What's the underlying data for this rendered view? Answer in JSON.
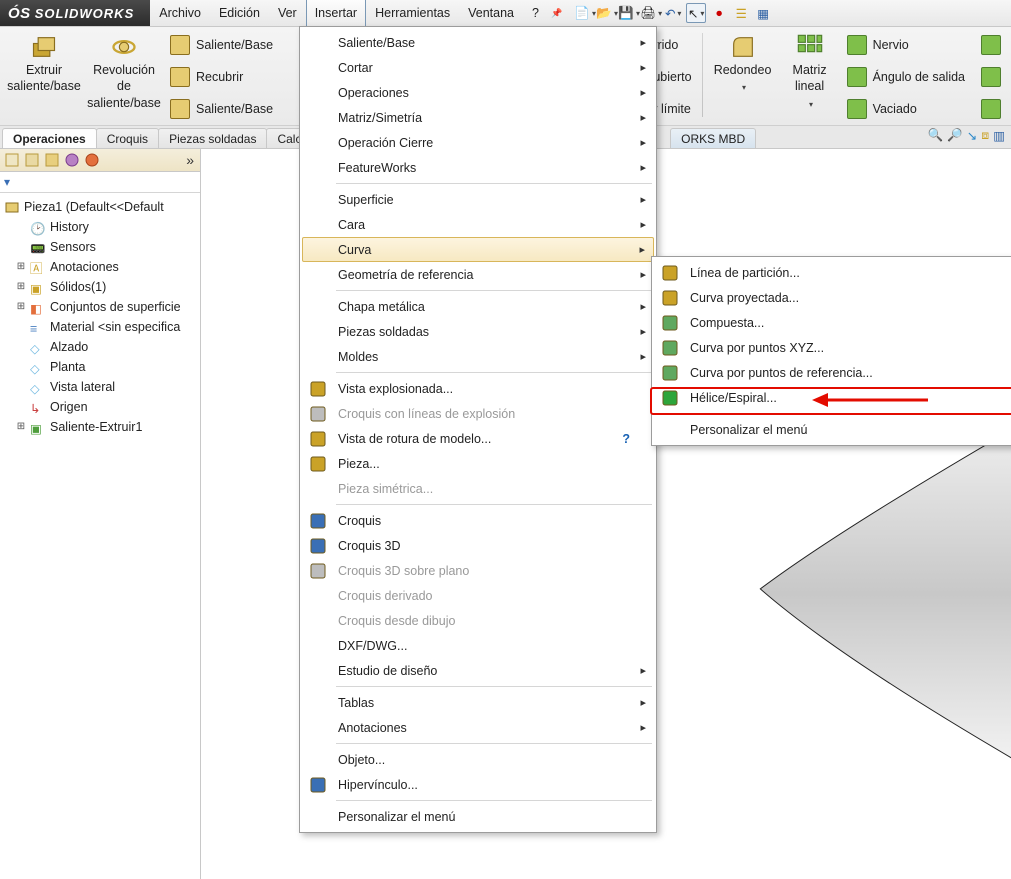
{
  "app": {
    "brand_prefix": "S",
    "brand": "SOLIDWORKS"
  },
  "menubar": {
    "items": [
      "Archivo",
      "Edición",
      "Ver",
      "Insertar",
      "Herramientas",
      "Ventana",
      "?"
    ],
    "open_index": 3
  },
  "ribbon": {
    "big": [
      {
        "label1": "Extruir",
        "label2": "saliente/base"
      },
      {
        "label1": "Revolución",
        "label2": "de",
        "label3": "saliente/base"
      }
    ],
    "col_a": [
      "Saliente/Base",
      "Recubrir",
      "Saliente/Base"
    ],
    "mid_right_partial": [
      "rrido",
      "ubierto",
      "r límite"
    ],
    "big2": [
      {
        "label1": "Redondeo"
      },
      {
        "label1": "Matriz",
        "label2": "lineal"
      }
    ],
    "col_b": [
      "Nervio",
      "Ángulo de salida",
      "Vaciado"
    ]
  },
  "ribtabs": {
    "tabs": [
      "Operaciones",
      "Croquis",
      "Piezas soldadas",
      "Calcu",
      "ORKS MBD"
    ],
    "active_index": 0
  },
  "tree": {
    "root": "Pieza1  (Default<<Default",
    "items": [
      {
        "label": "History"
      },
      {
        "label": "Sensors"
      },
      {
        "label": "Anotaciones",
        "expandable": true
      },
      {
        "label": "Sólidos(1)",
        "expandable": true
      },
      {
        "label": "Conjuntos de superficie",
        "expandable": true
      },
      {
        "label": "Material <sin especifica"
      },
      {
        "label": "Alzado"
      },
      {
        "label": "Planta"
      },
      {
        "label": "Vista lateral"
      },
      {
        "label": "Origen"
      },
      {
        "label": "Saliente-Extruir1",
        "expandable": true
      }
    ]
  },
  "menu_insertar": [
    {
      "label": "Saliente/Base",
      "submenu": true
    },
    {
      "label": "Cortar",
      "submenu": true
    },
    {
      "label": "Operaciones",
      "submenu": true
    },
    {
      "label": "Matriz/Simetría",
      "submenu": true
    },
    {
      "label": "Operación Cierre",
      "submenu": true
    },
    {
      "label": "FeatureWorks",
      "submenu": true
    },
    {
      "sep": true
    },
    {
      "label": "Superficie",
      "submenu": true
    },
    {
      "label": "Cara",
      "submenu": true
    },
    {
      "label": "Curva",
      "submenu": true,
      "highlight": true
    },
    {
      "label": "Geometría de referencia",
      "submenu": true
    },
    {
      "sep": true
    },
    {
      "label": "Chapa metálica",
      "submenu": true
    },
    {
      "label": "Piezas soldadas",
      "submenu": true
    },
    {
      "label": "Moldes",
      "submenu": true
    },
    {
      "sep": true
    },
    {
      "label": "Vista explosionada...",
      "icon": "explode-icon"
    },
    {
      "label": "Croquis con líneas de explosión",
      "disabled": true,
      "icon": "explode-lines-icon"
    },
    {
      "label": "Vista de rotura de modelo...",
      "icon": "break-view-icon",
      "help": true
    },
    {
      "label": "Pieza...",
      "icon": "part-icon"
    },
    {
      "label": "Pieza simétrica...",
      "disabled": true
    },
    {
      "sep": true
    },
    {
      "label": "Croquis",
      "icon": "sketch-icon"
    },
    {
      "label": "Croquis 3D",
      "icon": "sketch3d-icon"
    },
    {
      "label": "Croquis 3D sobre plano",
      "disabled": true,
      "icon": "sketch3dplane-icon"
    },
    {
      "label": "Croquis derivado",
      "disabled": true
    },
    {
      "label": "Croquis desde dibujo",
      "disabled": true
    },
    {
      "label": "DXF/DWG..."
    },
    {
      "label": "Estudio de diseño",
      "submenu": true
    },
    {
      "sep": true
    },
    {
      "label": "Tablas",
      "submenu": true
    },
    {
      "label": "Anotaciones",
      "submenu": true
    },
    {
      "sep": true
    },
    {
      "label": "Objeto..."
    },
    {
      "label": "Hipervínculo...",
      "icon": "hyperlink-icon"
    },
    {
      "sep": true
    },
    {
      "label": "Personalizar el menú"
    }
  ],
  "menu_curva": [
    {
      "label": "Línea de partición...",
      "icon": "split-line-icon"
    },
    {
      "label": "Curva proyectada...",
      "icon": "projected-curve-icon"
    },
    {
      "label": "Compuesta...",
      "icon": "composite-curve-icon"
    },
    {
      "label": "Curva por puntos XYZ...",
      "icon": "curve-xyz-icon"
    },
    {
      "label": "Curva por puntos de referencia...",
      "icon": "curve-ref-icon"
    },
    {
      "label": "Hélice/Espiral...",
      "icon": "helix-icon",
      "boxed": true
    },
    {
      "sep": true
    },
    {
      "label": "Personalizar el menú"
    }
  ]
}
